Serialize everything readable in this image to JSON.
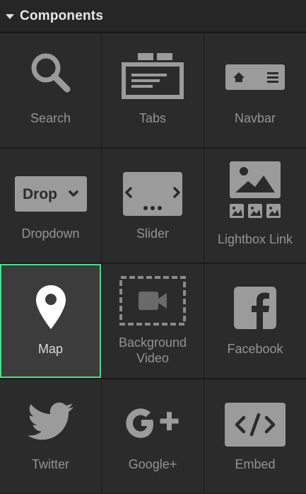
{
  "header": {
    "title": "Components"
  },
  "components": [
    {
      "label": "Search"
    },
    {
      "label": "Tabs"
    },
    {
      "label": "Navbar"
    },
    {
      "label": "Dropdown",
      "icon_text": "Drop"
    },
    {
      "label": "Slider"
    },
    {
      "label": "Lightbox Link"
    },
    {
      "label": "Map",
      "selected": true
    },
    {
      "label_lines": [
        "Background",
        "Video"
      ]
    },
    {
      "label": "Facebook"
    },
    {
      "label": "Twitter"
    },
    {
      "label": "Google+"
    },
    {
      "label": "Embed"
    }
  ],
  "colors": {
    "selected_border": "#4ddc8c",
    "icon": "#9b9b9b"
  }
}
